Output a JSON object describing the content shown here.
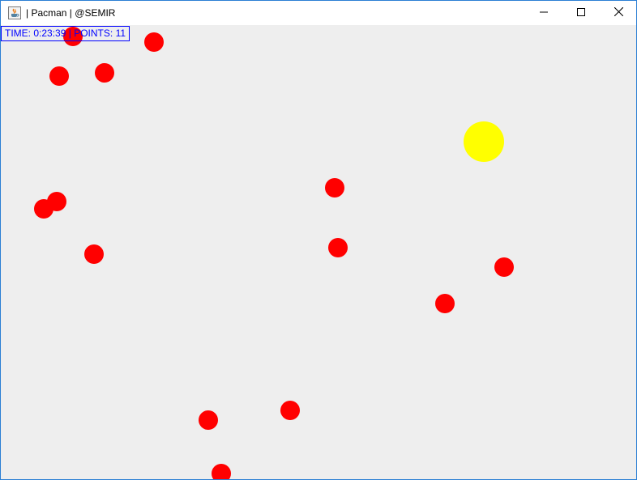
{
  "window": {
    "title": "| Pacman | @SEMIR",
    "border_color": "#2b7fd4",
    "icon": "java-cup-icon",
    "controls": {
      "minimize_icon": "minimize-icon",
      "maximize_icon": "maximize-icon",
      "close_icon": "close-icon"
    }
  },
  "hud": {
    "time_label": "TIME:",
    "time_value": "0:23:39",
    "separator": "|",
    "points_label": "POINTS:",
    "points_value": "11",
    "color": "#0000ff"
  },
  "game": {
    "background": "#eeeeee",
    "dot_color": "#ff0000",
    "pacman_color": "#ffff00"
  }
}
